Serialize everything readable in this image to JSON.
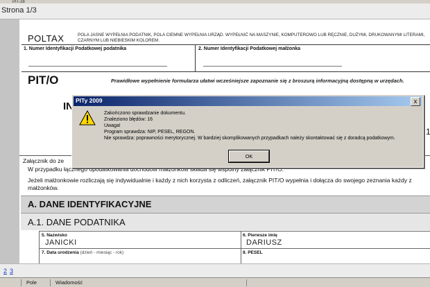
{
  "window": {
    "tab_label": "PIT-28",
    "page_indicator": "Strona 1/3"
  },
  "form": {
    "poltax": "POLTAX",
    "instructions": "POLA JASNE WYPEŁNIA PODATNIK, POLA CIEMNE WYPEŁNIA URZĄD. WYPEŁNIĆ NA MASZYNIE, KOMPUTEROWO LUB RĘCZNIE, DUŻYMI, DRUKOWANYMI LITERAMI, CZARNYM LUB NIEBIESKIM KOLOREM.",
    "field1_label": "1. Numer Identyfikacji Podatkowej podatnika",
    "field2_label": "2. Numer Identyfikacji Podatkowej małżonka",
    "form_code": "PIT/O",
    "form_note": "Prawidłowe wypełnienie formularza ułatwi wcześniejsze zapoznanie się z broszurą informacyjną dostępną w urzędach.",
    "heading_fragment": "IN",
    "right_fragment": "1",
    "attachment_line1": "Załącznik do ze",
    "attachment_line2": "W przypadku łącznego opodatkowania dochodów małżonków składa się wspólny załącznik PIT/O.",
    "attachment_line3": "Jeżeli małżonkowie rozliczają się indywidualnie i każdy z nich korzysta z odliczeń, załącznik PIT/O wypełnia i dołącza do swojego zeznania każdy z małżonków.",
    "section_a": "A. DANE IDENTYFIKACYJNE",
    "section_a1": "A.1. DANE PODATNIKA",
    "f5_label": "5. Nazwisko",
    "f5_value": "JANICKI",
    "f6_label": "6. Pierwsze imię",
    "f6_value": "DARIUSZ",
    "f7_label": "7. Data urodzenia",
    "f7_hint": "(dzień - miesiąc - rok)",
    "f8_label": "8. PESEL"
  },
  "dialog": {
    "title": "PITy 2009",
    "close": "x",
    "line1": "Zakończono sprawdzanie dokumentu.",
    "line2": "Znaleziono błędów: 16",
    "line3": "Uwaga!",
    "line4": "Program sprawdza: NIP, PESEL, REGON.",
    "line5": "Nie sprawdza: poprawności merytorycznej. W bardziej skomplikowanych przypadkach należy skontaktować się z doradcą podatkowym.",
    "ok_label": "OK"
  },
  "navigation": {
    "pages": [
      "2",
      "3"
    ]
  },
  "statusbar": {
    "field_label": "Pole",
    "message_label": "Wiadomość"
  }
}
